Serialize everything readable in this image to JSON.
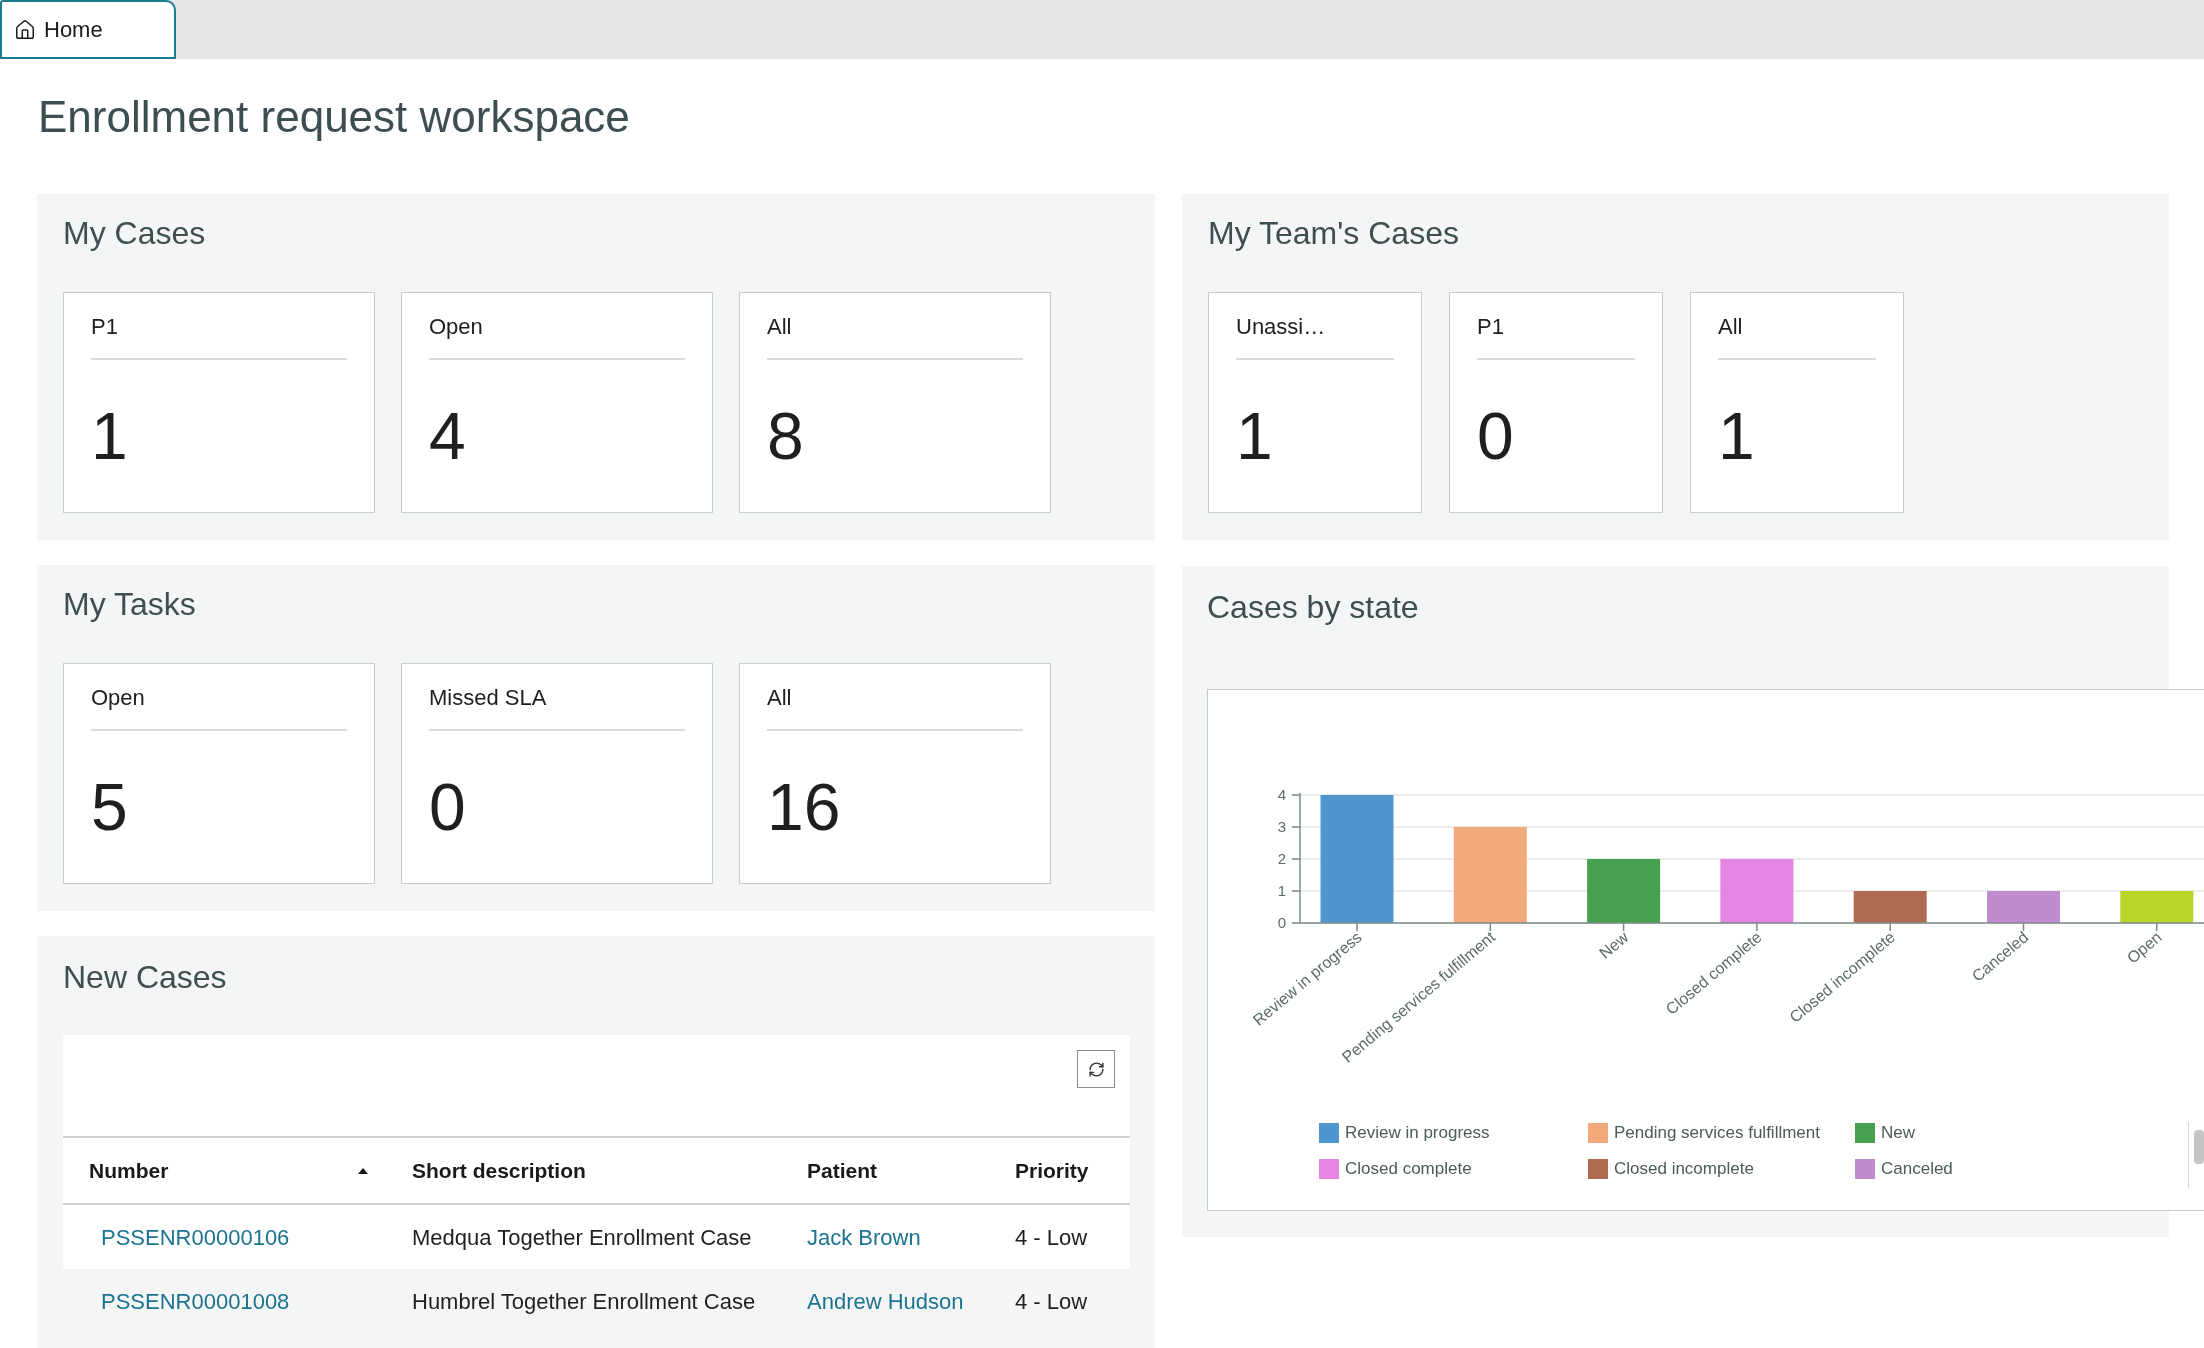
{
  "tabs": [
    {
      "label": "Home",
      "selected": true
    }
  ],
  "page_title": "Enrollment request workspace",
  "my_cases": {
    "title": "My Cases",
    "cards": [
      {
        "label": "P1",
        "count": "1"
      },
      {
        "label": "Open",
        "count": "4"
      },
      {
        "label": "All",
        "count": "8"
      }
    ]
  },
  "my_teams_cases": {
    "title": "My Team's Cases",
    "cards": [
      {
        "label": "Unassi…",
        "count": "1"
      },
      {
        "label": "P1",
        "count": "0"
      },
      {
        "label": "All",
        "count": "1"
      }
    ]
  },
  "my_tasks": {
    "title": "My Tasks",
    "cards": [
      {
        "label": "Open",
        "count": "5"
      },
      {
        "label": "Missed SLA",
        "count": "0"
      },
      {
        "label": "All",
        "count": "16"
      }
    ]
  },
  "cases_by_state": {
    "title": "Cases by state",
    "chart_data": {
      "type": "bar",
      "categories": [
        "Review in progress",
        "Pending services fulfillment",
        "New",
        "Closed complete",
        "Closed incomplete",
        "Canceled",
        "Open"
      ],
      "values": [
        4,
        3,
        2,
        2,
        1,
        1,
        1
      ],
      "colors": [
        "#4f96d1",
        "#f3aa7b",
        "#47a04f",
        "#e584e2",
        "#b06a52",
        "#bf8ccf",
        "#b8d62a"
      ],
      "ylim": [
        0,
        4
      ],
      "yticks": [
        0,
        1,
        2,
        3,
        4
      ],
      "grid": true
    },
    "legend": [
      {
        "label": "Review in progress",
        "color": "#4f96d1"
      },
      {
        "label": "Pending services fulfillment",
        "color": "#f3aa7b"
      },
      {
        "label": "New",
        "color": "#47a04f"
      },
      {
        "label": "Closed complete",
        "color": "#e584e2"
      },
      {
        "label": "Closed incomplete",
        "color": "#b06a52"
      },
      {
        "label": "Canceled",
        "color": "#bf8ccf"
      }
    ]
  },
  "new_cases": {
    "title": "New Cases",
    "columns": [
      {
        "label": "Number",
        "sorted": true
      },
      {
        "label": "Short description",
        "sorted": false
      },
      {
        "label": "Patient",
        "sorted": false
      },
      {
        "label": "Priority",
        "sorted": false
      }
    ],
    "rows": [
      {
        "number": "PSSENR00000106",
        "short_description": "Medqua Together Enrollment Case",
        "patient": "Jack Brown",
        "priority": "4 - Low"
      },
      {
        "number": "PSSENR00001008",
        "short_description": "Humbrel Together Enrollment Case",
        "patient": "Andrew Hudson",
        "priority": "4 - Low"
      }
    ]
  }
}
